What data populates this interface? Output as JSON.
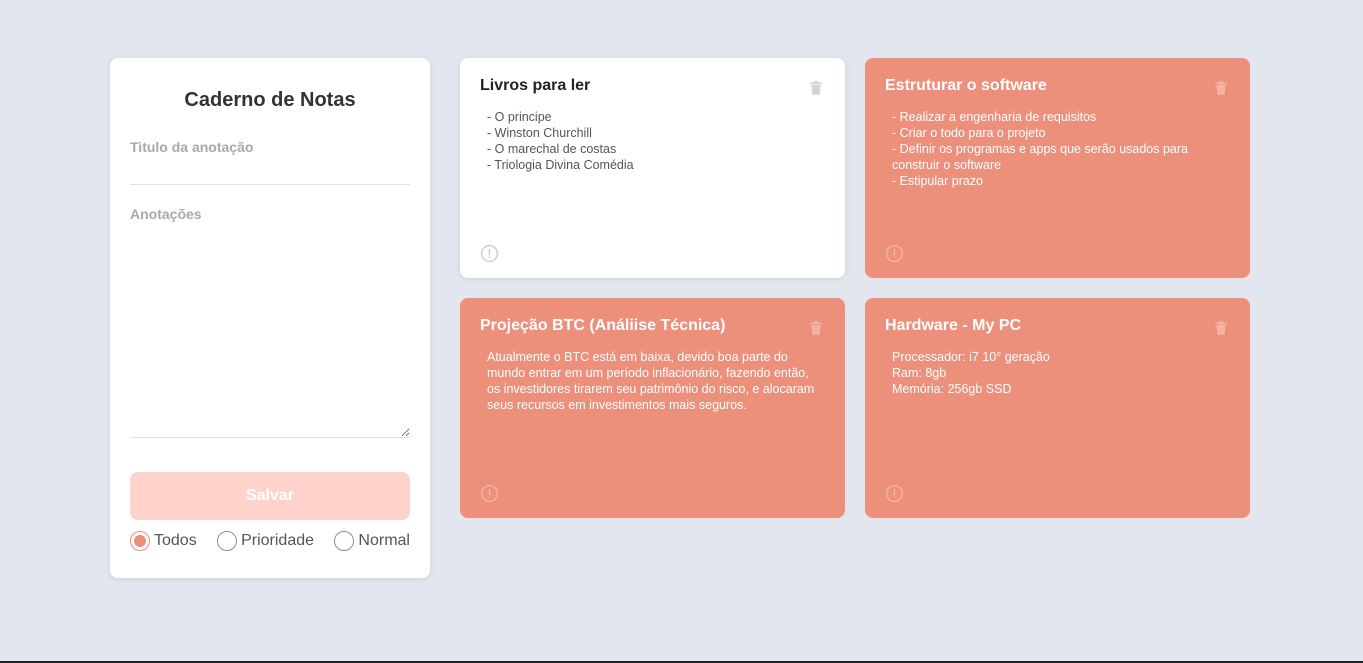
{
  "form": {
    "title": "Caderno de Notas",
    "title_label": "Titulo da anotação",
    "title_value": "",
    "notes_label": "Anotações",
    "notes_value": "",
    "save_label": "Salvar",
    "filters": [
      {
        "label": "Todos",
        "checked": true
      },
      {
        "label": "Prioridade",
        "checked": false
      },
      {
        "label": "Normal",
        "checked": false
      }
    ]
  },
  "notes": [
    {
      "title": "Livros para ler",
      "body": "- O principe\n- Winston Churchill\n- O marechal de costas\n- Triologia Divina Comédia",
      "priority": false
    },
    {
      "title": "Estruturar o software",
      "body": "- Realizar a engenharia de requisitos\n- Criar o todo para o projeto\n- Definir os programas e apps que serão usados para construir o software\n- Estipular prazo",
      "priority": true
    },
    {
      "title": "Projeção BTC (Análiise Técnica)",
      "body": "Atualmente o BTC está em baixa, devido boa parte do mundo entrar em um período inflacionário, fazendo então, os investidores tirarem seu patrimônio do risco, e alocaram seus recursos em investimentos mais seguros.",
      "priority": true
    },
    {
      "title": "Hardware - My PC",
      "body": "Processador: i7 10° geração\nRam: 8gb\nMemória: 256gb SSD",
      "priority": true
    }
  ],
  "icons": {
    "delete": "trash-icon",
    "priority": "alert-circle-icon"
  },
  "colors": {
    "background": "#e3e6ef",
    "accent": "#ec8f7b",
    "save_button": "#ffd3cb",
    "card": "#ffffff"
  }
}
